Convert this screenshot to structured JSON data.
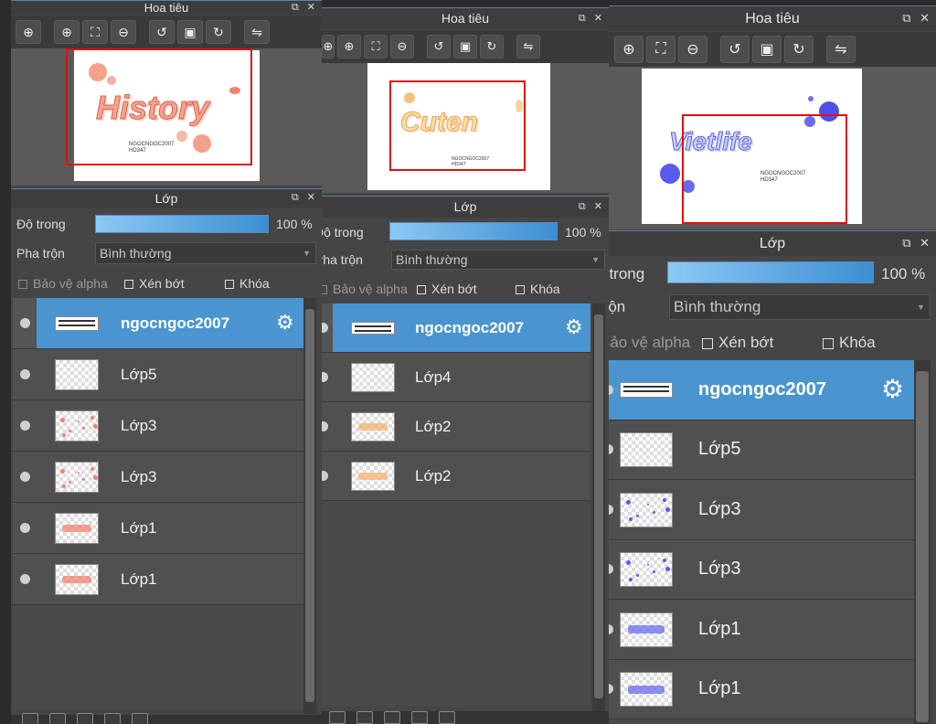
{
  "colors": {
    "selected_row": "#4a95d0",
    "slider": "#3b8fd2",
    "frame": "#e01010",
    "panel_bg": "#454545"
  },
  "toolbar_icons": [
    "zoom-fit-icon",
    "zoom-in-icon",
    "fit-screen-icon",
    "zoom-out-icon",
    "rotate-left-icon",
    "crop-icon",
    "rotate-right-icon",
    "flip-icon"
  ],
  "screens": [
    {
      "navigator": {
        "title": "Hoa tiêu",
        "art_text": "History",
        "signature": "NGOCNGOC2007\nHD347"
      },
      "layers_panel": {
        "title": "Lớp",
        "opacity_label": "Độ trong",
        "opacity_value": "100 %",
        "opacity_fraction": 1.0,
        "blend_label": "Pha trộn",
        "blend_value": "Bình thường",
        "protect_alpha": "Bảo vệ alpha",
        "clip": "Xén bớt",
        "lock": "Khóa",
        "layers": [
          {
            "name": "ngocngoc2007",
            "selected": true,
            "thumb": "text"
          },
          {
            "name": "Lớp5",
            "thumb": "empty"
          },
          {
            "name": "Lớp3",
            "thumb": "dots-red"
          },
          {
            "name": "Lớp3",
            "thumb": "dots-red"
          },
          {
            "name": "Lớp1",
            "thumb": "word-red"
          },
          {
            "name": "Lớp1",
            "thumb": "word-red"
          }
        ]
      }
    },
    {
      "navigator": {
        "title": "Hoa tiêu",
        "art_text": "Cuten",
        "signature": "NGOCNGOC2007\nHD347"
      },
      "layers_panel": {
        "title": "Lớp",
        "opacity_label": "Độ trong",
        "opacity_value": "100 %",
        "opacity_fraction": 1.0,
        "blend_label": "Pha trộn",
        "blend_value": "Bình thường",
        "protect_alpha": "Bảo vệ alpha",
        "clip": "Xén bớt",
        "lock": "Khóa",
        "layers": [
          {
            "name": "ngocngoc2007",
            "selected": true,
            "thumb": "text"
          },
          {
            "name": "Lớp4",
            "thumb": "empty"
          },
          {
            "name": "Lớp2",
            "thumb": "word-orange"
          },
          {
            "name": "Lớp2",
            "thumb": "word-orange"
          }
        ]
      }
    },
    {
      "navigator": {
        "title": "Hoa tiêu",
        "art_text": "Vietlife",
        "signature": "NGOCNGOC2007\nHD347"
      },
      "layers_panel": {
        "title": "Lớp",
        "opacity_label": "Độ trong",
        "opacity_value": "100 %",
        "opacity_fraction": 1.0,
        "blend_label": "Pha trộn",
        "blend_value": "Bình thường",
        "protect_alpha": "Bảo vệ alpha",
        "clip": "Xén bớt",
        "lock": "Khóa",
        "layers": [
          {
            "name": "ngocngoc2007",
            "selected": true,
            "thumb": "text"
          },
          {
            "name": "Lớp5",
            "thumb": "empty"
          },
          {
            "name": "Lớp3",
            "thumb": "dots-blue"
          },
          {
            "name": "Lớp3",
            "thumb": "dots-blue"
          },
          {
            "name": "Lớp1",
            "thumb": "word-blue"
          },
          {
            "name": "Lớp1",
            "thumb": "word-blue"
          }
        ]
      }
    }
  ]
}
